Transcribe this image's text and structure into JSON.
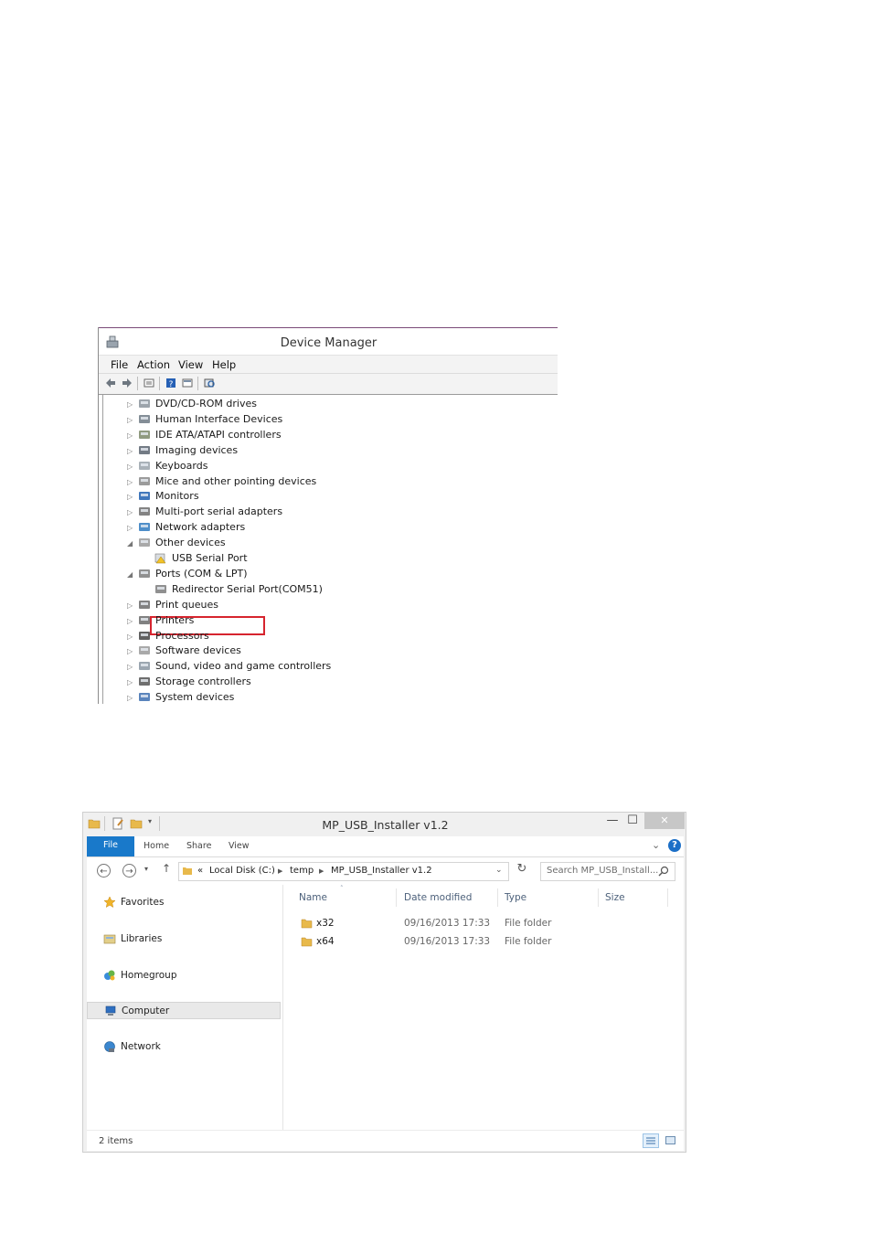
{
  "device_manager": {
    "title": "Device Manager",
    "menu": [
      "File",
      "Action",
      "View",
      "Help"
    ],
    "tree": [
      {
        "label": "DVD/CD-ROM drives",
        "icon": "dvd-drive-icon",
        "expanded": false,
        "level": 0
      },
      {
        "label": "Human Interface Devices",
        "icon": "hid-icon",
        "expanded": false,
        "level": 0
      },
      {
        "label": "IDE ATA/ATAPI controllers",
        "icon": "ide-controller-icon",
        "expanded": false,
        "level": 0
      },
      {
        "label": "Imaging devices",
        "icon": "camera-icon",
        "expanded": false,
        "level": 0
      },
      {
        "label": "Keyboards",
        "icon": "keyboard-icon",
        "expanded": false,
        "level": 0
      },
      {
        "label": "Mice and other pointing devices",
        "icon": "mouse-icon",
        "expanded": false,
        "level": 0
      },
      {
        "label": "Monitors",
        "icon": "monitor-icon",
        "expanded": false,
        "level": 0
      },
      {
        "label": "Multi-port serial adapters",
        "icon": "serial-adapter-icon",
        "expanded": false,
        "level": 0
      },
      {
        "label": "Network adapters",
        "icon": "network-adapter-icon",
        "expanded": false,
        "level": 0
      },
      {
        "label": "Other devices",
        "icon": "unknown-device-icon",
        "expanded": true,
        "level": 0
      },
      {
        "label": "USB Serial Port",
        "icon": "warning-device-icon",
        "level": 1,
        "highlighted": true
      },
      {
        "label": "Ports (COM & LPT)",
        "icon": "port-icon",
        "expanded": true,
        "level": 0
      },
      {
        "label": "Redirector Serial Port(COM51)",
        "icon": "port-icon",
        "level": 1
      },
      {
        "label": "Print queues",
        "icon": "printer-icon",
        "expanded": false,
        "level": 0
      },
      {
        "label": "Printers",
        "icon": "printer-icon",
        "expanded": false,
        "level": 0
      },
      {
        "label": "Processors",
        "icon": "processor-icon",
        "expanded": false,
        "level": 0
      },
      {
        "label": "Software devices",
        "icon": "software-device-icon",
        "expanded": false,
        "level": 0
      },
      {
        "label": "Sound, video and game controllers",
        "icon": "sound-icon",
        "expanded": false,
        "level": 0
      },
      {
        "label": "Storage controllers",
        "icon": "storage-controller-icon",
        "expanded": false,
        "level": 0
      },
      {
        "label": "System devices",
        "icon": "system-device-icon",
        "expanded": false,
        "level": 0
      }
    ],
    "highlight_color": "#d6242e"
  },
  "explorer": {
    "title": "MP_USB_Installer v1.2",
    "ribbon_tabs": [
      "File",
      "Home",
      "Share",
      "View"
    ],
    "breadcrumb": [
      "Local Disk (C:)",
      "temp",
      "MP_USB_Installer v1.2"
    ],
    "breadcrumb_overflow": "«",
    "search_placeholder": "Search MP_USB_Install...",
    "nav": [
      {
        "label": "Favorites",
        "icon": "star-icon"
      },
      {
        "label": "Libraries",
        "icon": "libraries-icon"
      },
      {
        "label": "Homegroup",
        "icon": "homegroup-icon"
      },
      {
        "label": "Computer",
        "icon": "computer-icon",
        "selected": true
      },
      {
        "label": "Network",
        "icon": "network-icon"
      }
    ],
    "columns": [
      "Name",
      "Date modified",
      "Type",
      "Size"
    ],
    "files": [
      {
        "name": "x32",
        "date": "09/16/2013 17:33",
        "type": "File folder",
        "size": ""
      },
      {
        "name": "x64",
        "date": "09/16/2013 17:33",
        "type": "File folder",
        "size": ""
      }
    ],
    "status": "2 items",
    "accent_color": "#1979ca"
  }
}
